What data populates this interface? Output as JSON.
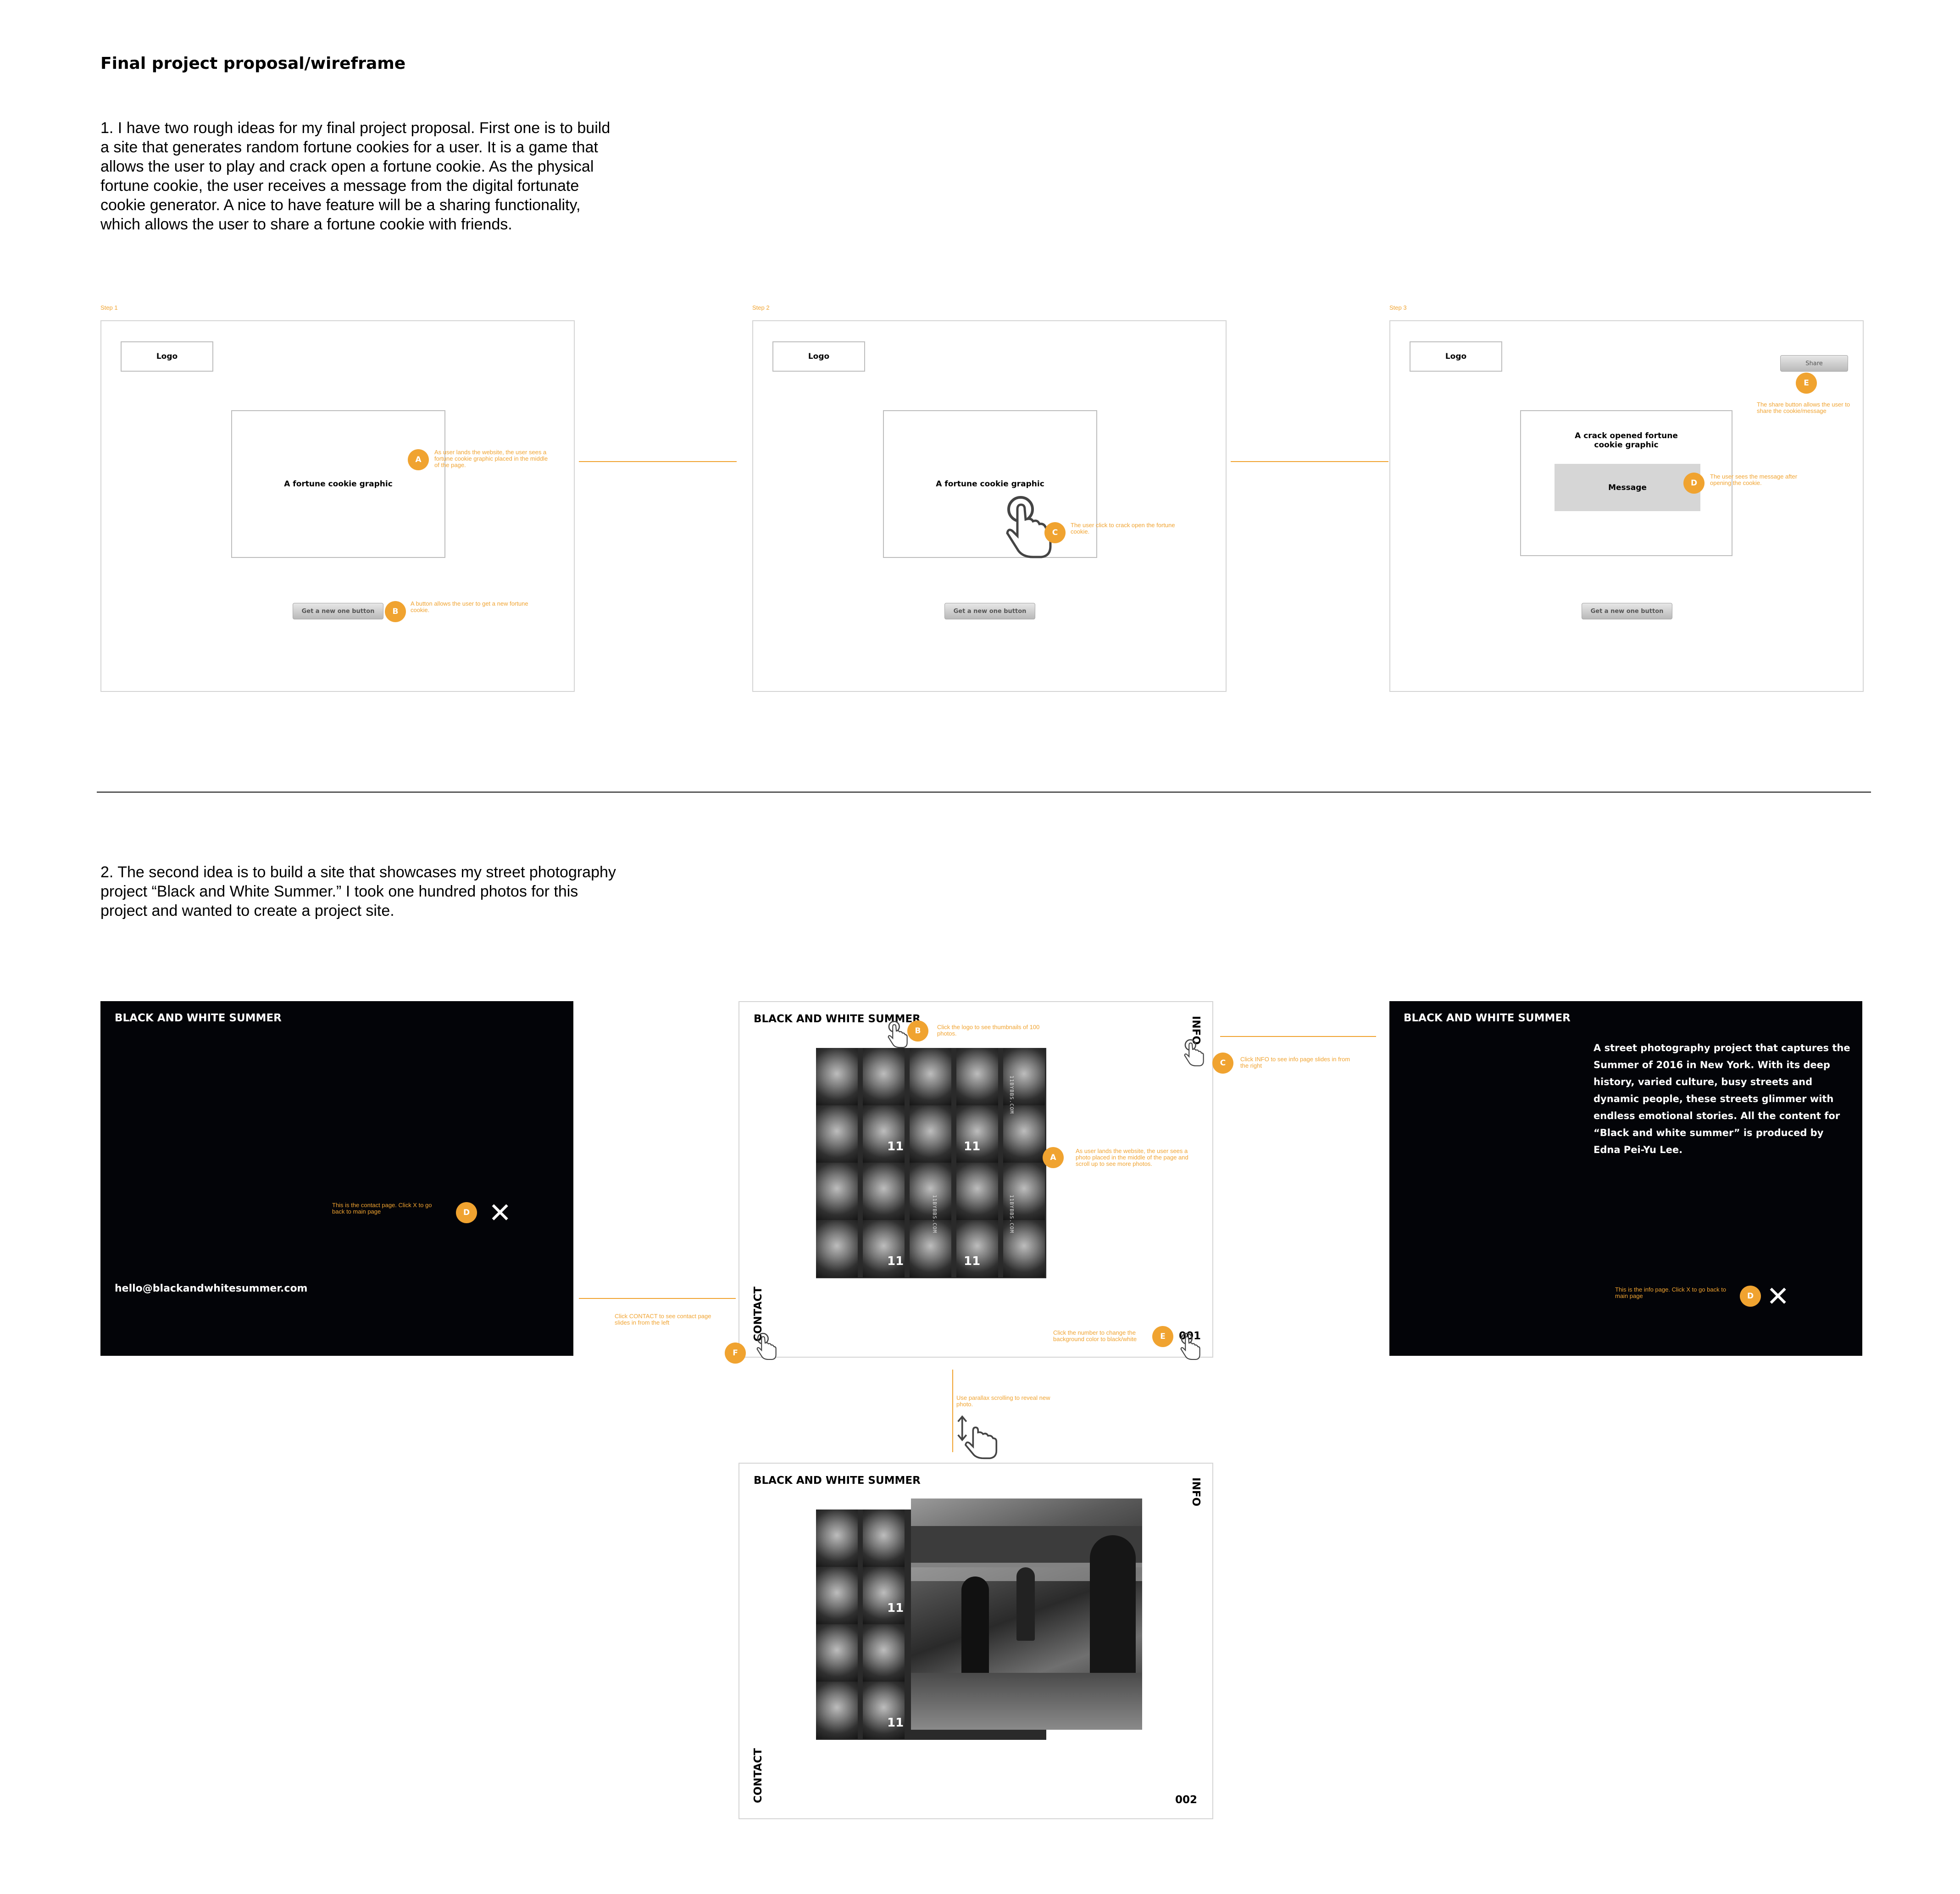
{
  "title": "Final project proposal/wireframe",
  "idea1": {
    "text": "1. I have two rough ideas for my final project proposal. First one is to build a site that generates random fortune cookies for a user. It is a game that allows the user to play and crack open a fortune cookie. As the physical fortune cookie, the user receives a message from the digital fortunate cookie generator. A nice to have feature will be a sharing functionality, which allows the user to share a fortune cookie with friends.",
    "steps": [
      {
        "label": "Step 1",
        "logo": "Logo",
        "cookie": "A fortune cookie graphic",
        "button": "Get a new one button"
      },
      {
        "label": "Step 2",
        "logo": "Logo",
        "cookie": "A fortune cookie graphic",
        "button": "Get a new one button"
      },
      {
        "label": "Step 3",
        "logo": "Logo",
        "cookie": "A crack opened fortune cookie graphic",
        "message": "Message",
        "button": "Get a new one button",
        "share": "Share"
      }
    ],
    "notes": {
      "a": "As user lands the website, the user sees a fortune cookie graphic placed in the middle of the page.",
      "b": "A button allows the user to get a new fortune cookie.",
      "c": "The user click to crack open the fortune cookie.",
      "d": "The user sees the message after opening the cookie.",
      "e": "The share button allows the user to share the cookie/message"
    },
    "markers": {
      "a": "A",
      "b": "B",
      "c": "C",
      "d": "D",
      "e": "E"
    }
  },
  "idea2": {
    "text": "2. The second idea is to build a site that showcases my street photography project “Black and White Summer.” I took one hundred photos for this project and wanted to create a project site.",
    "site_title": "BLACK AND WHITE SUMMER",
    "contact_email": "hello@blackandwhitesummer.com",
    "info_link": "INFO",
    "contact_link": "CONTACT",
    "page_number_1": "001",
    "page_number_2": "002",
    "tile_number": "11",
    "tile_text": "11BYBBS.COM",
    "info_text": "A street photography project that captures the Summer of 2016 in New York. With its deep history, varied culture, busy streets and dynamic people, these streets glimmer with endless emotional stories.  All the content for “Black and white summer” is produced by Edna Pei-Yu Lee.",
    "close_symbol": "✕",
    "notes": {
      "a": "As user lands the website, the user sees a photo placed in the middle of the page and scroll up to see more photos.",
      "b": "Click the logo to see thumbnails of 100 photos.",
      "c": "Click INFO to see info page slides in from the right",
      "d_contact": "This is the contact page. Click X to go back to main page",
      "d_info": "This is the info page. Click X to go back to main page",
      "e": "Click the number to change the background color to black/white",
      "f": "Click CONTACT to see contact page slides in from the left",
      "scroll": "Use parallax scrolling to reveal new photo."
    },
    "markers": {
      "a": "A",
      "b": "B",
      "c": "C",
      "d": "D",
      "e": "E",
      "f": "F"
    }
  },
  "colors": {
    "accent": "#f0a330",
    "dark": "#030408"
  },
  "icons": [
    "hand-pointer-icon",
    "hand-scroll-icon",
    "close-icon"
  ]
}
